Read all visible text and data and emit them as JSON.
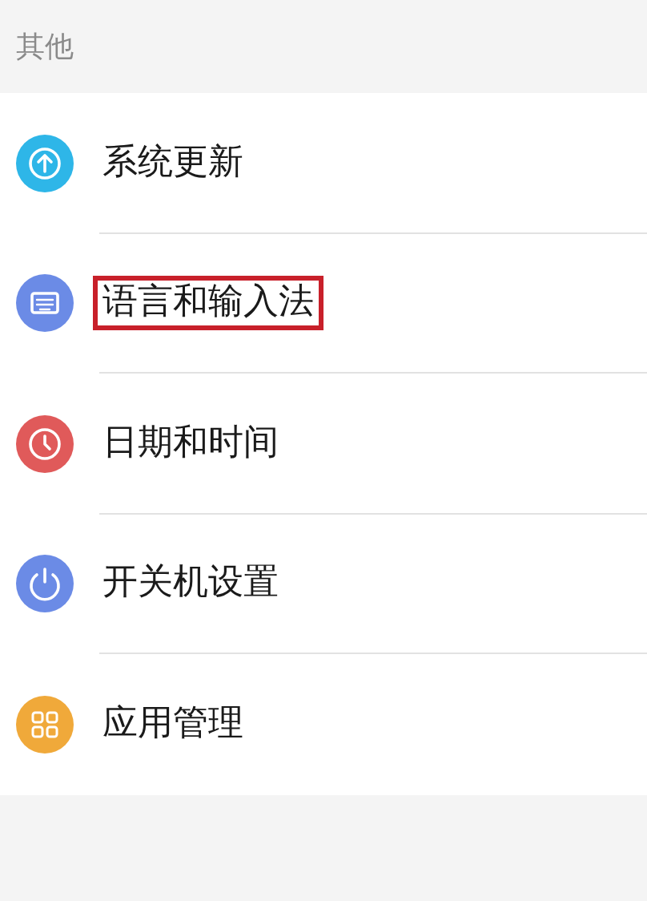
{
  "section_header": "其他",
  "items": [
    {
      "label": "系统更新",
      "kind": "update",
      "color": "#2eb6e8",
      "highlighted": false
    },
    {
      "label": "语言和输入法",
      "kind": "keyboard",
      "color": "#6b8be6",
      "highlighted": true
    },
    {
      "label": "日期和时间",
      "kind": "clock",
      "color": "#e05a5a",
      "highlighted": false
    },
    {
      "label": "开关机设置",
      "kind": "power",
      "color": "#6b8be6",
      "highlighted": false
    },
    {
      "label": "应用管理",
      "kind": "apps",
      "color": "#f0a93a",
      "highlighted": false
    }
  ]
}
